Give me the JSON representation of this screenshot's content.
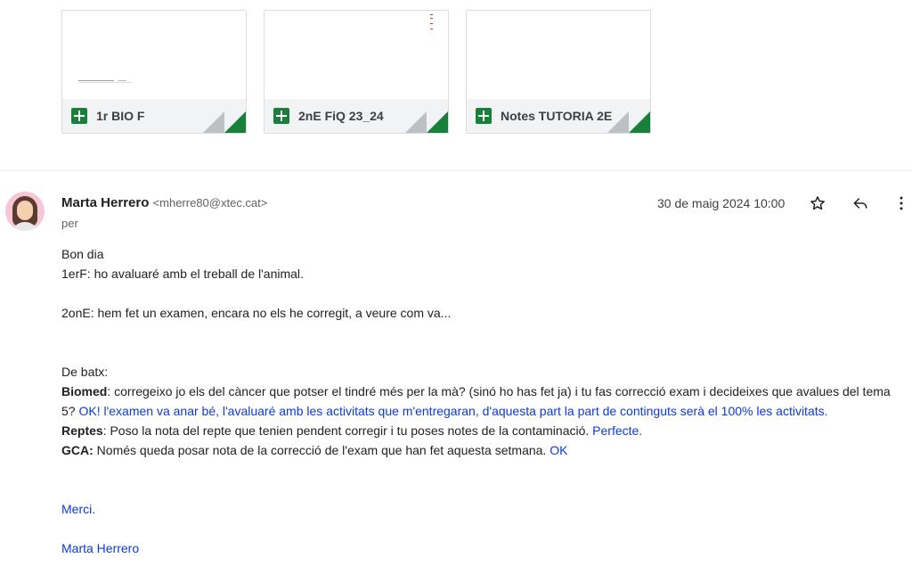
{
  "attachments": [
    {
      "name": "1r BIO F"
    },
    {
      "name": "2nE FiQ 23_24"
    },
    {
      "name": "Notes TUTORIA 2E"
    }
  ],
  "message": {
    "sender_name": "Marta Herrero",
    "sender_email": "<mherre80@xtec.cat>",
    "recipient": "per",
    "date": "30 de maig 2024 10:00",
    "greeting": "Bon dia",
    "line_1erF": "1erF: ho avaluaré amb el treball de l'animal.",
    "line_2onE": "2onE: hem fet un examen, encara no els he corregit, a veure com va...",
    "batx_heading": "De batx:",
    "biomed_label": "Biomed",
    "biomed_text": ": corregeixo jo els del càncer que potser el tindré més per la mà? (sinó ho has fet ja) i tu fas correcció exam i decideixes que avalues del tema 5? ",
    "biomed_reply": "OK! l'examen va anar bé, l'avaluaré amb les activitats que m'entregaran, d'aquesta part la part de continguts serà el 100% les activitats.",
    "reptes_label": "Reptes",
    "reptes_text": ": Poso la nota del repte que tenien pendent corregir i tu poses notes de la contaminació. ",
    "reptes_reply": "Perfecte.",
    "gca_label": "GCA:",
    "gca_text": " Només queda posar nota de la correcció de l'exam que han fet aquesta setmana. ",
    "gca_reply": "OK",
    "thanks": "Merci.",
    "signature": "Marta Herrero"
  },
  "icons": {
    "star": "star-icon",
    "reply": "reply-icon",
    "more": "more-vert-icon",
    "sheet": "google-sheets-icon"
  },
  "colors": {
    "sheets_green": "#188038",
    "reply_blue": "#0b3ad6"
  }
}
